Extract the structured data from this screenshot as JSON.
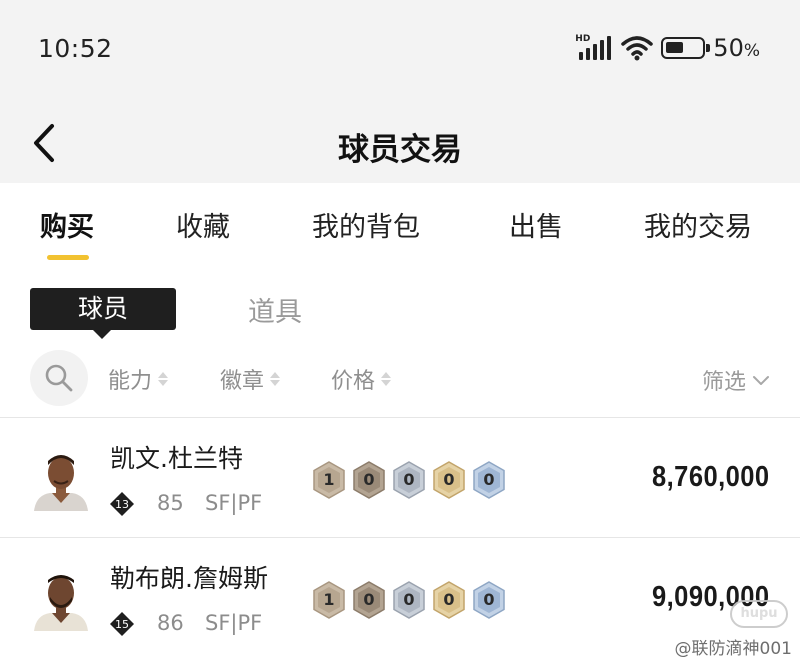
{
  "status_bar": {
    "time": "10:52",
    "network": "HD",
    "battery_level": 50,
    "battery_text": "50",
    "battery_unit": "%"
  },
  "header": {
    "title": "球员交易"
  },
  "tabs": [
    {
      "label": "购买",
      "active": true
    },
    {
      "label": "收藏",
      "active": false
    },
    {
      "label": "我的背包",
      "active": false
    },
    {
      "label": "出售",
      "active": false
    },
    {
      "label": "我的交易",
      "active": false
    }
  ],
  "sub_tabs": [
    {
      "label": "球员",
      "active": true
    },
    {
      "label": "道具",
      "active": false
    }
  ],
  "sort": {
    "items": [
      "能力",
      "徽章",
      "价格"
    ],
    "filter_label": "筛选"
  },
  "players": [
    {
      "name": "凯文.杜兰特",
      "level": "13",
      "overall": "85",
      "position": "SF|PF",
      "badges": [
        "1",
        "0",
        "0",
        "0",
        "0"
      ],
      "price": "8,760,000"
    },
    {
      "name": "勒布朗.詹姆斯",
      "level": "15",
      "overall": "86",
      "position": "SF|PF",
      "badges": [
        "1",
        "0",
        "0",
        "0",
        "0"
      ],
      "price": "9,090,000"
    }
  ],
  "watermark": {
    "text": "@联防滴神001",
    "logo_text": "hupu"
  },
  "colors": {
    "accent": "#f2c230",
    "badge_bronze": "#b7a690",
    "badge_brown": "#9a8a78",
    "badge_silver": "#aeb6c2",
    "badge_gold": "#d9c08a",
    "badge_blue": "#9fb6d4"
  }
}
